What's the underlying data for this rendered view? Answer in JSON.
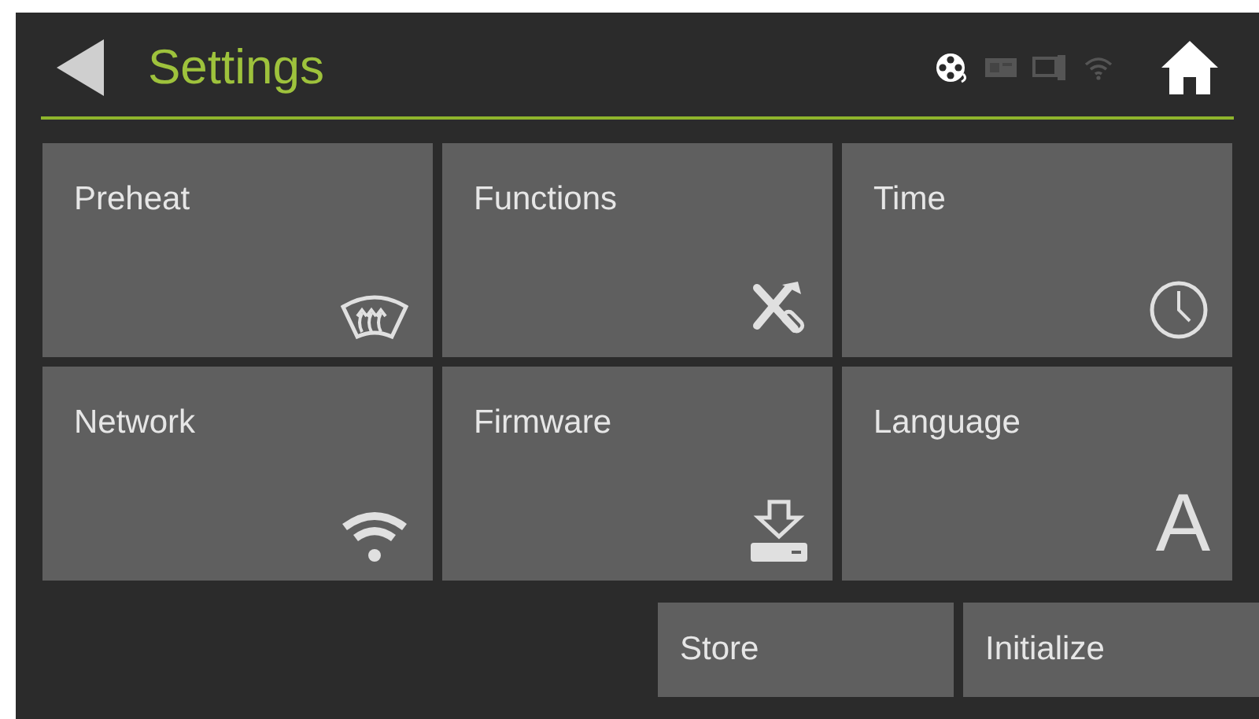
{
  "header": {
    "title": "Settings",
    "status_icons": [
      {
        "kind": "reel",
        "active": true
      },
      {
        "kind": "card",
        "active": false
      },
      {
        "kind": "monitor",
        "active": false
      },
      {
        "kind": "wifi",
        "active": false
      }
    ]
  },
  "tiles": [
    {
      "label": "Preheat",
      "kind": "defrost"
    },
    {
      "label": "Functions",
      "kind": "tools"
    },
    {
      "label": "Time",
      "kind": "clock"
    },
    {
      "label": "Network",
      "kind": "wifi"
    },
    {
      "label": "Firmware",
      "kind": "download"
    },
    {
      "label": "Language",
      "kind": "letter",
      "glyph": "A"
    }
  ],
  "buttons": [
    "Store",
    "Initialize"
  ]
}
